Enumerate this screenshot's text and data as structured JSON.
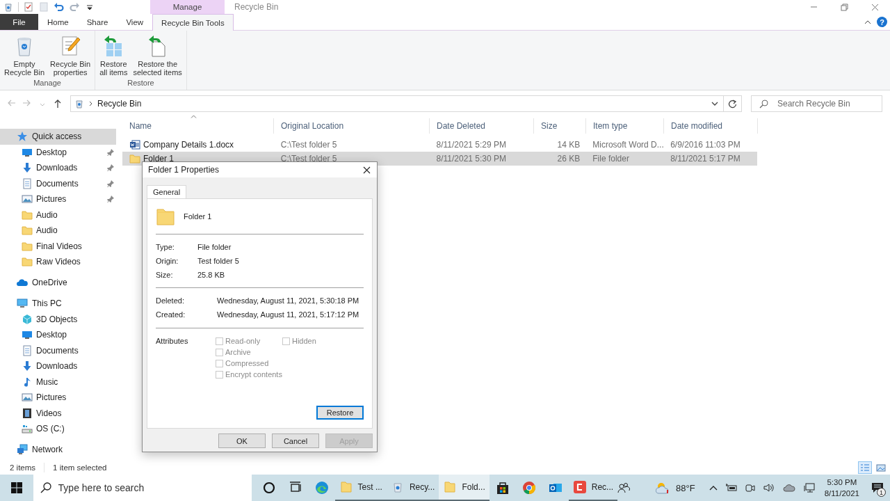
{
  "window": {
    "title": "Recycle Bin",
    "context_tab": "Manage"
  },
  "quick_access_toolbar": [
    {
      "kind": "bin"
    },
    {
      "kind": "checklist"
    },
    {
      "kind": "page"
    },
    {
      "kind": "undo"
    },
    {
      "kind": "redo"
    },
    {
      "kind": "caret"
    }
  ],
  "ribbon_tabs": [
    {
      "label": "File",
      "kind": "file",
      "selected": false
    },
    {
      "label": "Home",
      "kind": "tab",
      "selected": false
    },
    {
      "label": "Share",
      "kind": "tab",
      "selected": false
    },
    {
      "label": "View",
      "kind": "tab",
      "selected": false
    },
    {
      "label": "Recycle Bin Tools",
      "kind": "tab",
      "selected": true
    }
  ],
  "help": "?",
  "ribbon_groups": [
    {
      "label": "Manage",
      "buttons": [
        {
          "label": "Empty\nRecycle Bin",
          "kind": "bin"
        },
        {
          "label": "Recycle Bin\nproperties",
          "kind": "properties"
        }
      ]
    },
    {
      "label": "Restore",
      "buttons": [
        {
          "label": "Restore\nall items",
          "kind": "restore_all"
        },
        {
          "label": "Restore the\nselected items",
          "kind": "restore_selected"
        }
      ]
    }
  ],
  "address": {
    "path": "Recycle Bin"
  },
  "search": {
    "placeholder": "Search Recycle Bin"
  },
  "sidebar": {
    "items": [
      {
        "label": "Quick access",
        "kind": "star",
        "selected": true,
        "children": [
          {
            "label": "Desktop",
            "kind": "desktop",
            "pinned": true,
            "selected": false
          },
          {
            "label": "Downloads",
            "kind": "download",
            "pinned": true,
            "selected": false
          },
          {
            "label": "Documents",
            "kind": "documents",
            "pinned": true,
            "selected": false
          },
          {
            "label": "Pictures",
            "kind": "pictures",
            "pinned": true,
            "selected": false
          },
          {
            "label": "Audio",
            "kind": "folder",
            "pinned": false,
            "selected": false
          },
          {
            "label": "Audio",
            "kind": "folder",
            "pinned": false,
            "selected": false
          },
          {
            "label": "Final Videos",
            "kind": "folder",
            "pinned": false,
            "selected": false
          },
          {
            "label": "Raw Videos",
            "kind": "folder",
            "pinned": false,
            "selected": false
          }
        ]
      },
      {
        "label": "OneDrive",
        "kind": "cloud",
        "selected": false
      },
      {
        "label": "This PC",
        "kind": "pc",
        "selected": false,
        "children": [
          {
            "label": "3D Objects",
            "kind": "cube",
            "selected": false
          },
          {
            "label": "Desktop",
            "kind": "desktop",
            "selected": false
          },
          {
            "label": "Documents",
            "kind": "documents",
            "selected": false
          },
          {
            "label": "Downloads",
            "kind": "download",
            "selected": false
          },
          {
            "label": "Music",
            "kind": "music",
            "selected": false
          },
          {
            "label": "Pictures",
            "kind": "pictures",
            "selected": false
          },
          {
            "label": "Videos",
            "kind": "videos",
            "selected": false
          },
          {
            "label": "OS (C:)",
            "kind": "drive",
            "selected": false
          }
        ]
      },
      {
        "label": "Network",
        "kind": "network",
        "selected": false
      }
    ]
  },
  "file_list": {
    "columns": [
      {
        "label": "Name",
        "sorted": true
      },
      {
        "label": "Original Location",
        "sorted": false
      },
      {
        "label": "Date Deleted",
        "sorted": false
      },
      {
        "label": "Size",
        "sorted": false
      },
      {
        "label": "Item type",
        "sorted": false
      },
      {
        "label": "Date modified",
        "sorted": false
      }
    ],
    "rows": [
      {
        "kind": "word",
        "selected": false,
        "cells": [
          "Company Details 1.docx",
          "C:\\Test folder 5",
          "8/11/2021 5:29 PM",
          "14 KB",
          "Microsoft Word D...",
          "6/9/2016 11:03 PM"
        ]
      },
      {
        "kind": "folder",
        "selected": true,
        "cells": [
          "Folder 1",
          "C:\\Test folder 5",
          "8/11/2021 5:30 PM",
          "26 KB",
          "File folder",
          "8/11/2021 5:17 PM"
        ]
      }
    ]
  },
  "status_bar": {
    "item_count": "2 items",
    "selection": "1 item selected"
  },
  "view_buttons": [
    {
      "kind": "details",
      "selected": true
    },
    {
      "kind": "large_icons",
      "selected": false
    }
  ],
  "dialog": {
    "title": "Folder 1 Properties",
    "tabs": [
      {
        "label": "General",
        "selected": true
      }
    ],
    "name": "Folder 1",
    "properties": [
      {
        "label": "Type:",
        "value": "File folder"
      },
      {
        "label": "Origin:",
        "value": "Test folder 5"
      },
      {
        "label": "Size:",
        "value": "25.8 KB"
      }
    ],
    "dates": [
      {
        "label": "Deleted:",
        "value": "Wednesday, August 11, 2021, 5:30:18 PM"
      },
      {
        "label": "Created:",
        "value": "Wednesday, August 11, 2021, 5:17:12 PM"
      }
    ],
    "attributes_label": "Attributes",
    "attributes": [
      {
        "label": "Read-only",
        "checked": false,
        "disabled": true
      },
      {
        "label": "Hidden",
        "checked": false,
        "disabled": true
      },
      {
        "label": "Archive",
        "checked": false,
        "disabled": true
      },
      {
        "label": "Compressed",
        "checked": false,
        "disabled": true
      },
      {
        "label": "Encrypt contents",
        "checked": false,
        "disabled": true
      }
    ],
    "restore_button": "Restore",
    "buttons": [
      {
        "label": "OK",
        "disabled": false
      },
      {
        "label": "Cancel",
        "disabled": false
      },
      {
        "label": "Apply",
        "disabled": true
      }
    ]
  },
  "taskbar": {
    "search": {
      "placeholder": "Type here to search"
    },
    "apps": [
      {
        "kind": "cortana",
        "running": false,
        "selected": false
      },
      {
        "kind": "taskview",
        "running": false,
        "selected": false
      },
      {
        "kind": "edge",
        "running": false,
        "selected": false
      },
      {
        "kind": "folder",
        "label": "Test ...",
        "running": true,
        "selected": false
      },
      {
        "kind": "bin",
        "label": "Recy...",
        "running": true,
        "selected": false
      },
      {
        "kind": "folder",
        "label": "Fold...",
        "running": true,
        "selected": true
      },
      {
        "kind": "store",
        "running": false,
        "selected": false
      },
      {
        "kind": "chrome",
        "running": false,
        "selected": false
      },
      {
        "kind": "outlook",
        "running": false,
        "selected": false
      },
      {
        "kind": "camtasia",
        "label": "Rec...",
        "running": true,
        "selected": false
      }
    ],
    "weather": "88°F",
    "time": "5:30 PM",
    "date": "8/11/2021",
    "notification_count": "1"
  }
}
